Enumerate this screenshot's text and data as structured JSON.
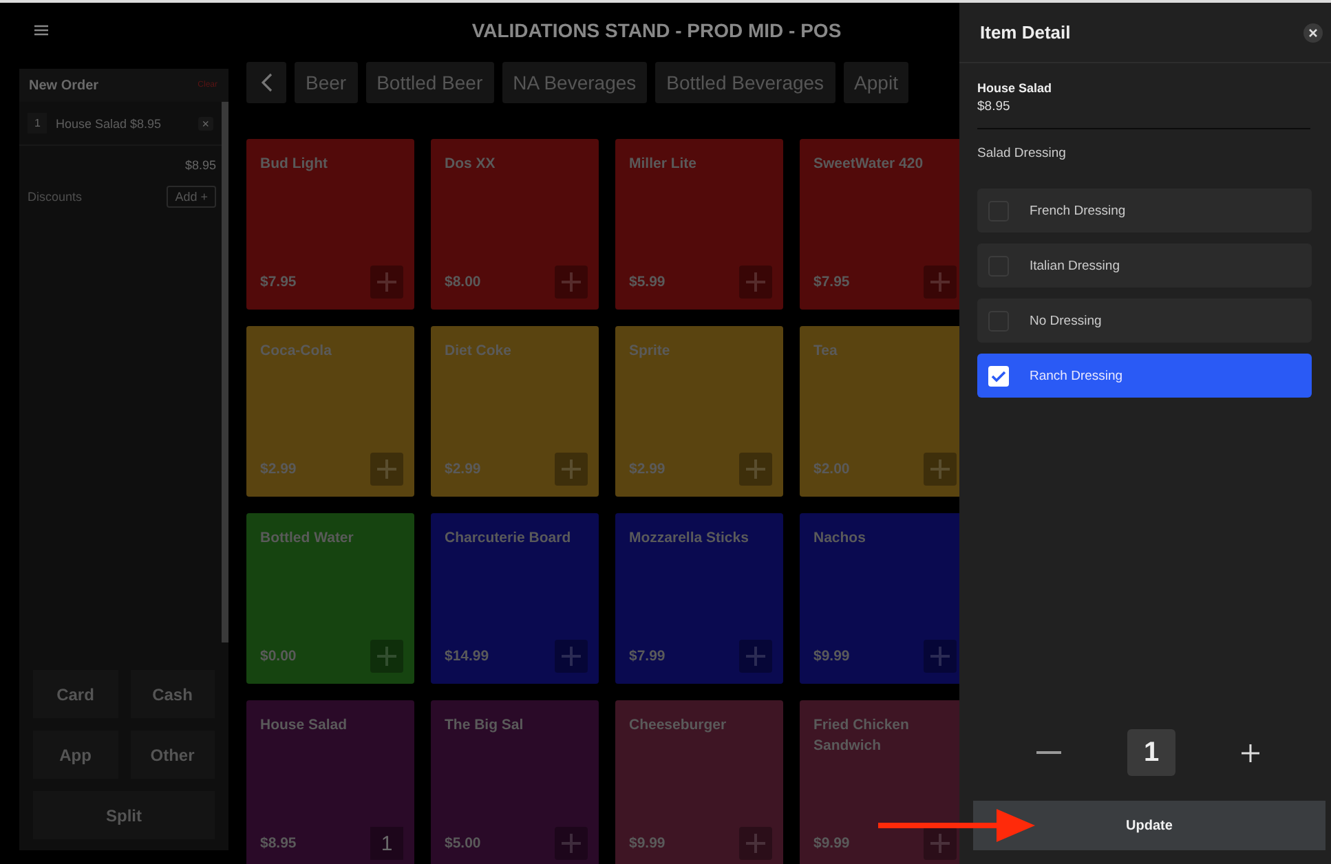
{
  "window": {
    "title": "VALIDATIONS STAND - PROD MID - POS"
  },
  "order": {
    "title": "New Order",
    "clear": "Clear",
    "lines": [
      {
        "qty": "1",
        "name": "House Salad $8.95",
        "remove": "×"
      }
    ],
    "total": "$8.95",
    "discounts_label": "Discounts",
    "discounts_button": "Add +"
  },
  "payment_buttons": [
    "Card",
    "Cash",
    "App",
    "Other",
    "Split"
  ],
  "categories": [
    {
      "label": "Beer"
    },
    {
      "label": "Bottled Beer"
    },
    {
      "label": "NA Beverages"
    },
    {
      "label": "Bottled Beverages"
    },
    {
      "label": "Appit"
    }
  ],
  "tiles": [
    {
      "name": "Bud Light",
      "price": "$7.95",
      "color": "#520a0a"
    },
    {
      "name": "Dos XX",
      "price": "$8.00",
      "color": "#520a0a"
    },
    {
      "name": "Miller Lite",
      "price": "$5.99",
      "color": "#520a0a"
    },
    {
      "name": "SweetWater 420",
      "price": "$7.95",
      "color": "#520a0a"
    },
    {
      "name": "Coca-Cola",
      "price": "$2.99",
      "color": "#5a4410"
    },
    {
      "name": "Diet Coke",
      "price": "$2.99",
      "color": "#5a4410"
    },
    {
      "name": "Sprite",
      "price": "$2.99",
      "color": "#5a4410"
    },
    {
      "name": "Tea",
      "price": "$2.00",
      "color": "#5a4410"
    },
    {
      "name": "Bottled Water",
      "price": "$0.00",
      "color": "#164410"
    },
    {
      "name": "Charcuterie Board",
      "price": "$14.99",
      "color": "#0a0a50"
    },
    {
      "name": "Mozzarella Sticks",
      "price": "$7.99",
      "color": "#0a0a50"
    },
    {
      "name": "Nachos",
      "price": "$9.99",
      "color": "#0a0a50"
    },
    {
      "name": "House Salad",
      "price": "$8.95",
      "color": "#2a0a28",
      "count": "1"
    },
    {
      "name": "The Big Sal",
      "price": "$5.00",
      "color": "#2a0a28"
    },
    {
      "name": "Cheeseburger",
      "price": "$9.99",
      "color": "#3e1524"
    },
    {
      "name": "Fried Chicken Sandwich",
      "price": "$9.99",
      "color": "#3e1524"
    }
  ],
  "detail": {
    "title": "Item Detail",
    "item_name": "House Salad",
    "item_price": "$8.95",
    "group_label": "Salad Dressing",
    "options": [
      {
        "label": "French Dressing",
        "checked": false
      },
      {
        "label": "Italian Dressing",
        "checked": false
      },
      {
        "label": "No Dressing",
        "checked": false
      },
      {
        "label": "Ranch Dressing",
        "checked": true
      }
    ],
    "quantity": "1",
    "update_button": "Update"
  }
}
